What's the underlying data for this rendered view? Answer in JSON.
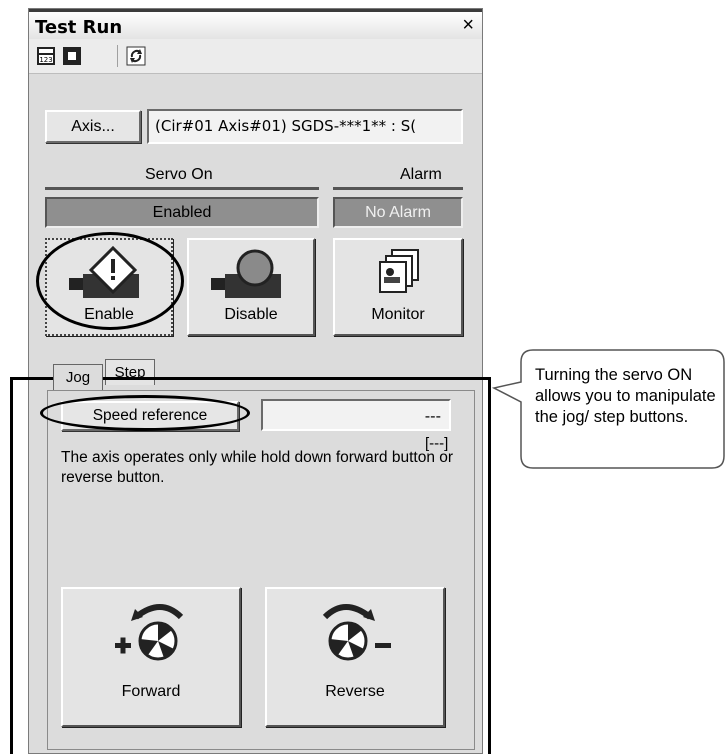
{
  "window": {
    "title": "Test Run",
    "close_symbol": "×"
  },
  "toolbar": {
    "icons": [
      "calculator-icon",
      "stop-icon",
      "refresh-icon"
    ]
  },
  "axis": {
    "button_label": "Axis...",
    "value": "(Cir#01 Axis#01) SGDS-***1** : S("
  },
  "servo": {
    "label": "Servo On",
    "status": "Enabled"
  },
  "alarm": {
    "label": "Alarm",
    "status": "No Alarm"
  },
  "actions": {
    "enable_label": "Enable",
    "disable_label": "Disable",
    "monitor_label": "Monitor"
  },
  "tabs": [
    {
      "label": "Jog",
      "selected": true
    },
    {
      "label": "Step",
      "selected": false
    }
  ],
  "jog": {
    "speed_reference_label": "Speed reference",
    "speed_value": "---",
    "speed_unit": "[---]",
    "description": "The axis operates only while hold down forward button or reverse button.",
    "forward_label": "Forward",
    "reverse_label": "Reverse"
  },
  "annotation": {
    "callout_text": "Turning the servo ON allows you to manipulate the jog/ step buttons."
  },
  "colors": {
    "panel": "#dcdcdc",
    "status_fill": "#8f8f8f",
    "annotation": "#000000"
  }
}
